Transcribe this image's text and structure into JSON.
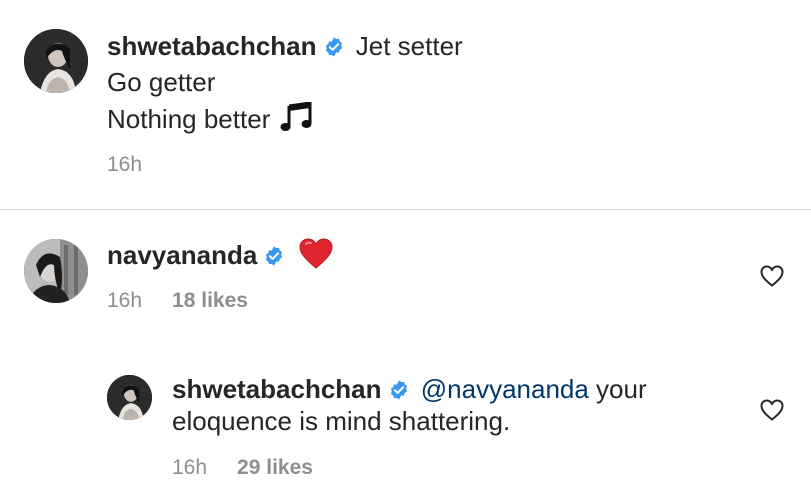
{
  "comments": [
    {
      "username": "shwetabachchan",
      "verified": true,
      "lines": [
        "Jet setter",
        "Go getter",
        "Nothing better"
      ],
      "emoji": "music-notes",
      "time": "16h"
    },
    {
      "username": "navyananda",
      "verified": true,
      "emoji": "red-heart",
      "time": "16h",
      "likes": "18 likes"
    }
  ],
  "reply": {
    "username": "shwetabachchan",
    "verified": true,
    "mention": "@navyananda",
    "text_part1": " your",
    "text_part2": "eloquence is mind shattering.",
    "time": "16h",
    "likes": "29 likes"
  },
  "colors": {
    "verified_blue": "#3897f0",
    "mention_blue": "#00376b",
    "meta_gray": "#8e8e8e",
    "heart_red": "#e0242e",
    "divider": "#dbdbdb"
  }
}
